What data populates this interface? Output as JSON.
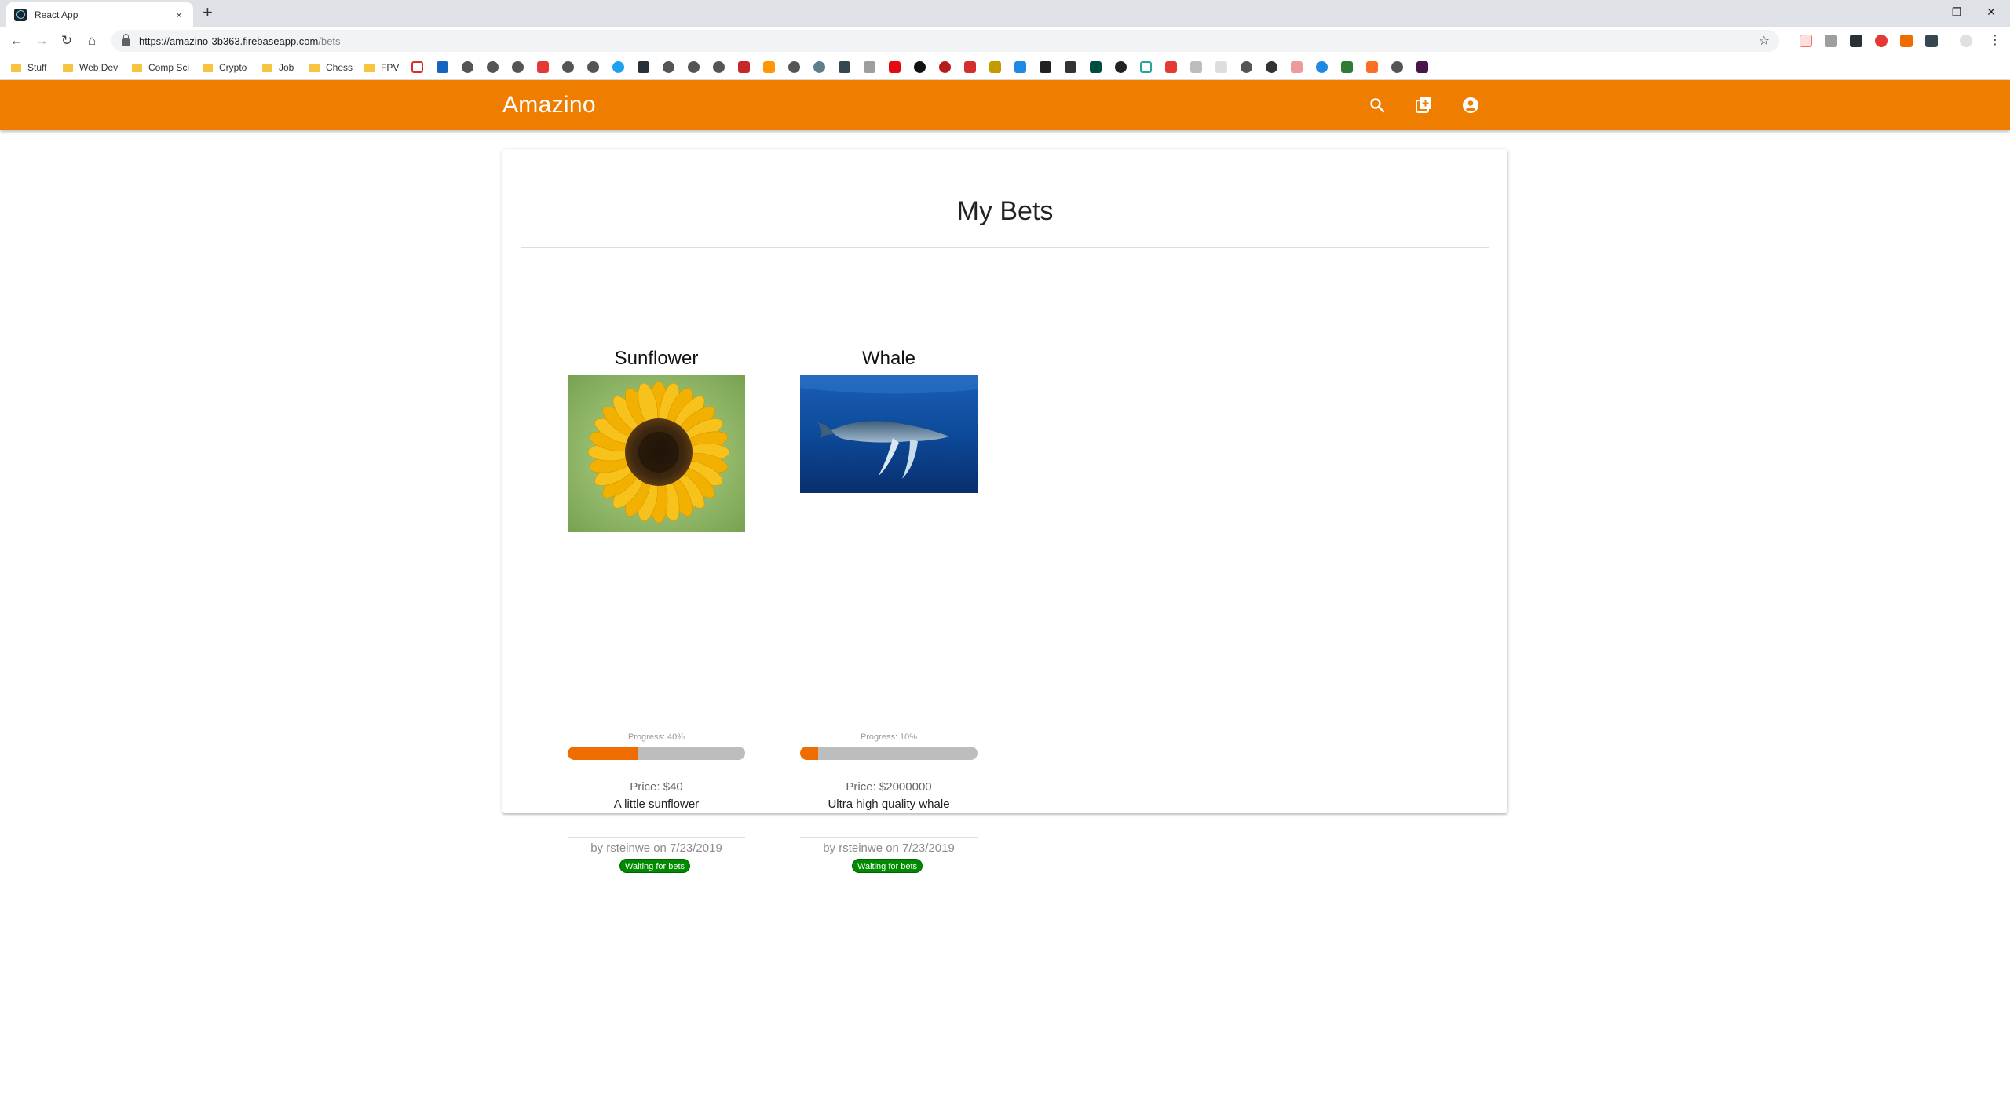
{
  "browser": {
    "tab_title": "React App",
    "tab_close": "×",
    "new_tab": "+",
    "url_host": "https://amazino-3b363.firebaseapp.com",
    "url_path": "/bets",
    "window_controls": [
      "–",
      "❐",
      "✕"
    ],
    "bookmark_folders": [
      "Stuff",
      "Web Dev",
      "Comp Sci",
      "Crypto",
      "Job",
      "Chess",
      "FPV"
    ]
  },
  "app": {
    "brand": "Amazino",
    "accent_color": "#ef7d00",
    "icons": [
      "search-icon",
      "add-box-icon",
      "account-circle-icon"
    ]
  },
  "page": {
    "title": "My Bets"
  },
  "bets": [
    {
      "name": "Sunflower",
      "image": "sunflower-photo",
      "progress_label": "Progress: 40%",
      "progress": 40,
      "price": "Price: $40",
      "description": "A little sunflower",
      "byline": "by rsteinwe on 7/23/2019",
      "status": "Waiting for bets",
      "status_color": "#008a00"
    },
    {
      "name": "Whale",
      "image": "whale-photo",
      "progress_label": "Progress: 10%",
      "progress": 10,
      "price": "Price: $2000000",
      "description": "Ultra high quality whale",
      "byline": "by rsteinwe on 7/23/2019",
      "status": "Waiting for bets",
      "status_color": "#008a00"
    }
  ]
}
